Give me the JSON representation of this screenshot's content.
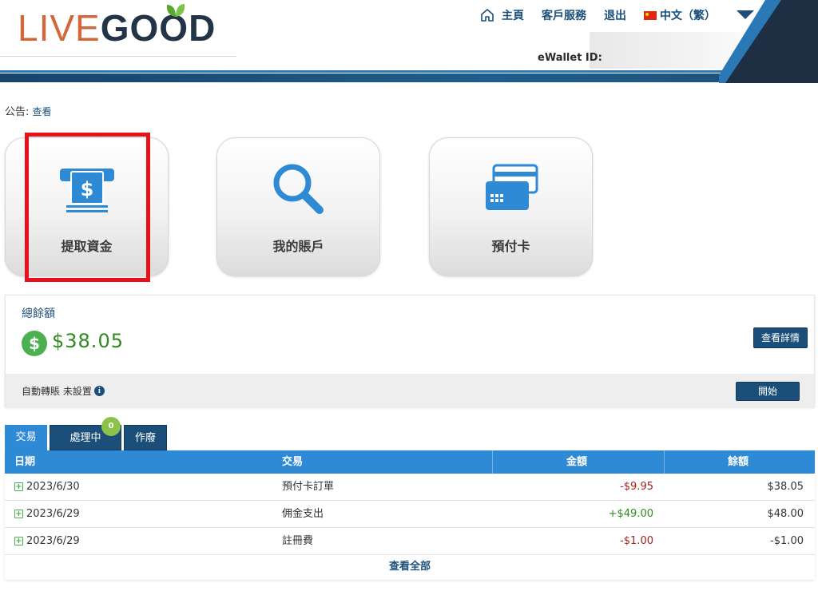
{
  "header": {
    "logo": {
      "part1": "LIVE",
      "part2": "GOOD"
    },
    "nav": [
      {
        "label": "主頁"
      },
      {
        "label": "客戶服務"
      },
      {
        "label": "退出"
      },
      {
        "label": "中文（繁）"
      }
    ],
    "ewallet_label": "eWallet ID:"
  },
  "announcement": {
    "label": "公告:",
    "link": "查看"
  },
  "tiles": [
    {
      "label": "提取資金",
      "icon": "atm-withdraw-icon"
    },
    {
      "label": "我的賬戶",
      "icon": "magnifier-icon"
    },
    {
      "label": "預付卡",
      "icon": "credit-cards-icon"
    }
  ],
  "balance": {
    "title": "總餘額",
    "amount": "$38.05",
    "details_button": "查看詳情",
    "auto_transfer_label": "自動轉賬 未設置",
    "start_button": "開始"
  },
  "tabs": [
    {
      "label": "交易"
    },
    {
      "label": "處理中",
      "badge": "0"
    },
    {
      "label": "作廢"
    }
  ],
  "table": {
    "headers": [
      "日期",
      "交易",
      "金額",
      "餘額"
    ],
    "rows": [
      {
        "date": "2023/6/30",
        "type": "預付卡訂單",
        "amount": "-$9.95",
        "balance": "$38.05"
      },
      {
        "date": "2023/6/29",
        "type": "佣金支出",
        "amount": "+$49.00",
        "balance": "$48.00"
      },
      {
        "date": "2023/6/29",
        "type": "註冊費",
        "amount": "-$1.00",
        "balance": "-$1.00"
      }
    ],
    "view_all": "查看全部"
  },
  "colors": {
    "navy": "#1b4f7a",
    "blue": "#2f8ad6",
    "green": "#2e8b1e",
    "red_highlight": "#e8111a",
    "negative": "#a3231e"
  }
}
